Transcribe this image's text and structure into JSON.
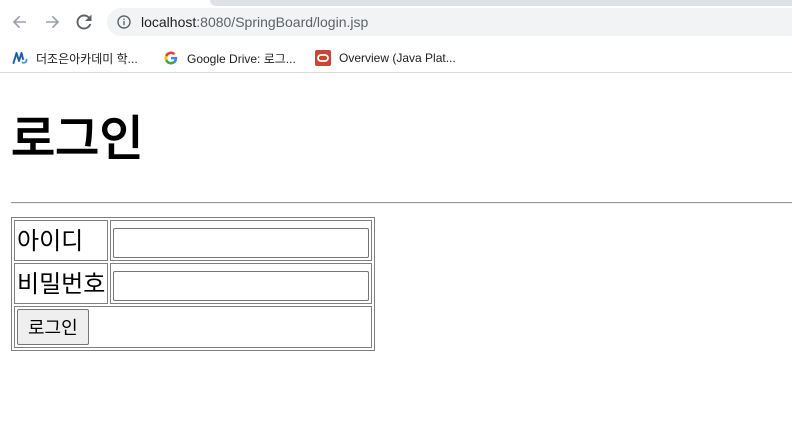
{
  "browser": {
    "url_host": "localhost",
    "url_path": ":8080/SpringBoard/login.jsp",
    "bookmarks": [
      {
        "label": "더조은아카데미 학...",
        "icon": "academy-favicon"
      },
      {
        "label": "Google Drive: 로그...",
        "icon": "google-favicon"
      },
      {
        "label": "Overview (Java Plat...",
        "icon": "oracle-favicon"
      }
    ],
    "colors": {
      "toolbar_icon": "#5f6368",
      "omnibox_bg": "#f1f3f4",
      "oracle_red": "#c74634"
    }
  },
  "page": {
    "title": "로그인",
    "form": {
      "id_label": "아이디",
      "id_value": "",
      "password_label": "비밀번호",
      "password_value": "",
      "submit_label": "로그인"
    }
  }
}
